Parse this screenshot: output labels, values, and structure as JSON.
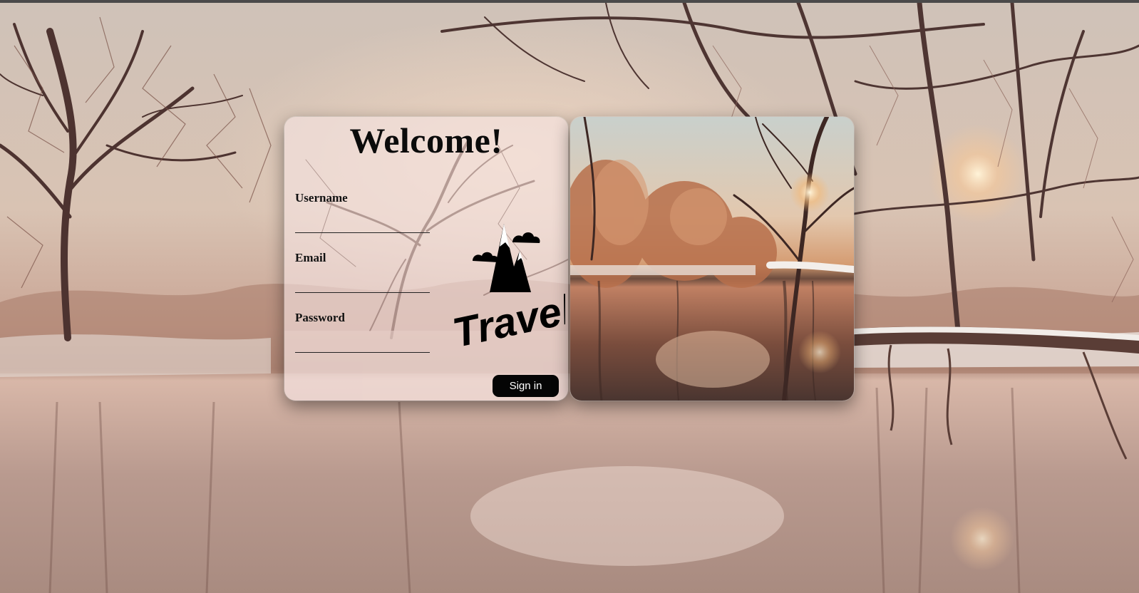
{
  "login_card": {
    "title": "Welcome!",
    "fields": [
      {
        "label": "Username",
        "value": "",
        "placeholder": ""
      },
      {
        "label": "Email",
        "value": "",
        "placeholder": ""
      },
      {
        "label": "Password",
        "value": "",
        "placeholder": ""
      }
    ],
    "signin_label": "Sign in"
  },
  "logo": {
    "text": "Travel",
    "icon": "mountain-clouds-icon"
  },
  "colors": {
    "button_bg": "#050505",
    "button_text": "#ffffff",
    "card_tint": "#f5e4e2",
    "background_tone": "#b9a49a"
  }
}
